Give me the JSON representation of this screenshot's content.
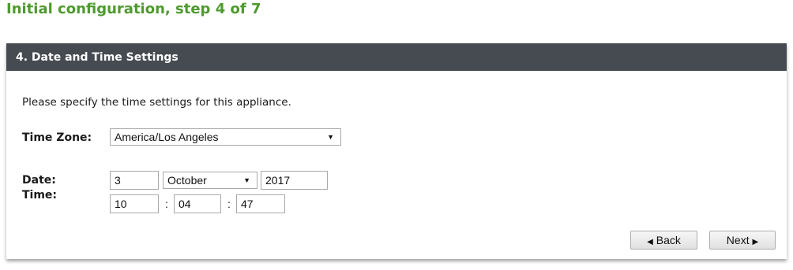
{
  "page": {
    "title": "Initial configuration, step 4 of 7"
  },
  "panel": {
    "header": "4. Date and Time Settings",
    "intro": "Please specify the time settings for this appliance."
  },
  "timezone": {
    "label": "Time Zone:",
    "value": "America/Los Angeles"
  },
  "date": {
    "label": "Date:",
    "day": "3",
    "month": "October",
    "year": "2017"
  },
  "time": {
    "label": "Time:",
    "hour": "10",
    "minute": "04",
    "second": "47",
    "separator": ":"
  },
  "buttons": {
    "back": "Back",
    "next": "Next"
  },
  "icons": {
    "dropdown": "triangle-down",
    "back": "triangle-left",
    "next": "triangle-right"
  },
  "colors": {
    "title": "#4e9a2f",
    "header_bg": "#464b51",
    "header_text": "#ffffff"
  }
}
